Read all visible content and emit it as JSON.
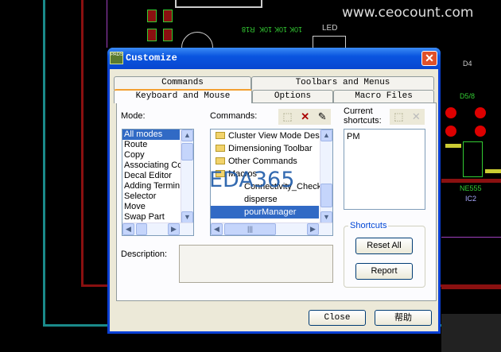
{
  "background": {
    "watermark": "www.ceocount.com",
    "pcb_labels": [
      "R18",
      "10K",
      "10K",
      "10K",
      "LED",
      "D4",
      "D5/8",
      "NE555",
      "IC2"
    ]
  },
  "dialog": {
    "title": "Customize",
    "app_icon": "PADS",
    "tabs_back": [
      "Commands",
      "Toolbars and Menus"
    ],
    "tabs_front": [
      "Keyboard and Mouse",
      "Options",
      "Macro Files"
    ],
    "mode_label": "Mode:",
    "modes": [
      "All modes",
      "Route",
      "Copy",
      "Associating Co",
      "Decal Editor",
      "Adding Termin",
      "Selector",
      "Move",
      "Swap Part"
    ],
    "commands_label": "Commands:",
    "commands": [
      {
        "label": "Cluster View Mode Desi",
        "type": "folder"
      },
      {
        "label": "Dimensioning Toolbar",
        "type": "folder"
      },
      {
        "label": "Other Commands",
        "type": "folder"
      },
      {
        "label": "Macros",
        "type": "folder"
      },
      {
        "label": "Connectivity_Check",
        "type": "item"
      },
      {
        "label": "disperse",
        "type": "item"
      },
      {
        "label": "pourManager",
        "type": "item",
        "selected": true
      }
    ],
    "current_label_1": "Current",
    "current_label_2": "shortcuts:",
    "shortcuts": [
      "PM"
    ],
    "shortcuts_group": "Shortcuts",
    "reset_all": "Reset All",
    "report": "Report",
    "description_label": "Description:",
    "close": "Close",
    "help": "帮助",
    "overlay_logo": "EDA365"
  }
}
